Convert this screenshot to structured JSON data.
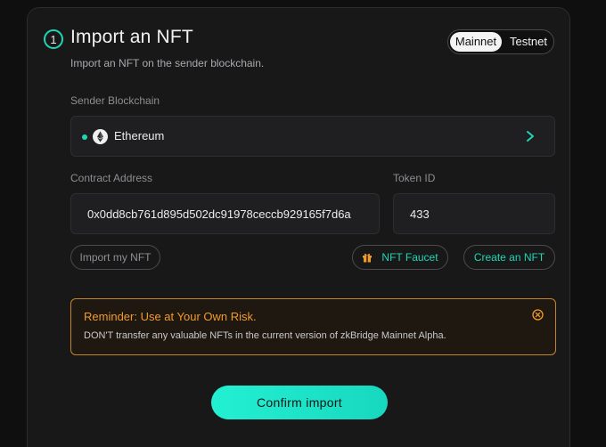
{
  "header": {
    "step_number": "1",
    "title": "Import an NFT",
    "subtitle": "Import an NFT on the sender blockchain."
  },
  "network_toggle": {
    "options": [
      "Mainnet",
      "Testnet"
    ],
    "selected": "Mainnet"
  },
  "sender": {
    "label": "Sender Blockchain",
    "chain_name": "Ethereum",
    "chain_icon": "ethereum-icon"
  },
  "contract": {
    "label": "Contract Address",
    "value": "0x0dd8cb761d895d502dc91978ceccb929165f7d6a"
  },
  "token": {
    "label": "Token ID",
    "value": "433"
  },
  "buttons": {
    "import_my": "Import my NFT",
    "faucet": "NFT Faucet",
    "create": "Create an NFT",
    "confirm": "Confirm import"
  },
  "reminder": {
    "title": "Reminder: Use at Your Own Risk.",
    "text": "DON'T transfer any valuable NFTs in the current version of zkBridge Mainnet Alpha."
  },
  "colors": {
    "accent": "#1fd6b5",
    "warning": "#f09a2e",
    "background": "#181819"
  }
}
